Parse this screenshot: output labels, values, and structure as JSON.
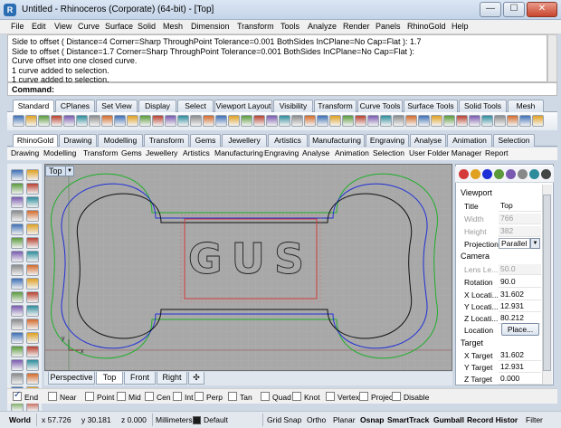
{
  "window": {
    "title": "Untitled - Rhinoceros (Corporate) (64-bit) - [Top]",
    "app_icon": "R",
    "buttons": {
      "minimize": "—",
      "maximize": "☐",
      "close": "✕"
    }
  },
  "menu": [
    "File",
    "Edit",
    "View",
    "Curve",
    "Surface",
    "Solid",
    "Mesh",
    "Dimension",
    "Transform",
    "Tools",
    "Analyze",
    "Render",
    "Panels",
    "RhinoGold",
    "Help"
  ],
  "history": [
    "Side to offset ( Distance=4  Corner=Sharp  ThroughPoint  Tolerance=0.001  BothSides  InCPlane=No  Cap=Flat ): 1.7",
    "Side to offset ( Distance=1.7  Corner=Sharp  ThroughPoint  Tolerance=0.001  BothSides  InCPlane=No  Cap=Flat ):",
    "Curve offset into one closed curve.",
    "1 curve added to selection.",
    "1 curve added to selection."
  ],
  "command": {
    "label": "Command:",
    "value": ""
  },
  "toolbar_tabs_1": [
    "Standard",
    "CPlanes",
    "Set View",
    "Display",
    "Select",
    "Viewport Layout",
    "Visibility",
    "Transform",
    "Curve Tools",
    "Surface Tools",
    "Solid Tools",
    "Mesh"
  ],
  "toolbar_tabs_2": [
    "RhinoGold",
    "Drawing",
    "Modelling",
    "Transform",
    "Gems",
    "Jewellery",
    "Artistics",
    "Manufacturing",
    "Engraving",
    "Analyse",
    "Animation",
    "Selection"
  ],
  "text_toolbar": [
    "Drawing",
    "Modelling",
    "Transform",
    "Gems",
    "Jewellery",
    "Artistics",
    "Manufacturing",
    "Engraving",
    "Analyse",
    "Animation",
    "Selection",
    "User Folder Manager",
    "Report"
  ],
  "viewport": {
    "title": "Top",
    "arrow": "▼",
    "engraved_text": "GUS",
    "axis_y": "y",
    "axis_x": "x"
  },
  "viewport_tabs": [
    "Perspective",
    "Top",
    "Front",
    "Right",
    "✣"
  ],
  "osnap": [
    {
      "label": "End",
      "checked": true
    },
    {
      "label": "Near",
      "checked": false
    },
    {
      "label": "Point",
      "checked": false
    },
    {
      "label": "Mid",
      "checked": false
    },
    {
      "label": "Cen",
      "checked": false
    },
    {
      "label": "Int",
      "checked": false
    },
    {
      "label": "Perp",
      "checked": false
    },
    {
      "label": "Tan",
      "checked": false
    },
    {
      "label": "Quad",
      "checked": false
    },
    {
      "label": "Knot",
      "checked": false
    },
    {
      "label": "Vertex",
      "checked": false
    },
    {
      "label": "Project",
      "checked": false
    },
    {
      "label": "Disable",
      "checked": false
    }
  ],
  "status": {
    "world": "World",
    "x": "x 57.726",
    "y": "y 30.181",
    "z": "z 0.000",
    "units": "Millimeters",
    "layer": "Default",
    "grid_snap": "Grid Snap",
    "ortho": "Ortho",
    "planar": "Planar",
    "osnap": "Osnap",
    "smarttrack": "SmartTrack",
    "gumball": "Gumball",
    "record_history": "Record Histor",
    "filter": "Filter"
  },
  "properties": {
    "viewport_header": "Viewport",
    "title_label": "Title",
    "title_value": "Top",
    "width_label": "Width",
    "width_value": "766",
    "height_label": "Height",
    "height_value": "382",
    "projection_label": "Projection",
    "projection_value": "Parallel",
    "camera_header": "Camera",
    "lens_label": "Lens Le...",
    "lens_value": "50.0",
    "rotation_label": "Rotation",
    "rotation_value": "90.0",
    "xloc_label": "X Locati...",
    "xloc_value": "31.602",
    "yloc_label": "Y Locati...",
    "yloc_value": "12.931",
    "zloc_label": "Z Locati...",
    "zloc_value": "80.212",
    "location_label": "Location",
    "location_button": "Place...",
    "target_header": "Target",
    "xtarget_label": "X Target",
    "xtarget_value": "31.602",
    "ytarget_label": "Y Target",
    "ytarget_value": "12.931",
    "ztarget_label": "Z Target",
    "ztarget_value": "0.000"
  },
  "colors": {
    "viewport_bg": "#a9a9a9",
    "grid_line": "#b4b4b4",
    "inner_curve": "#000000",
    "offset_blue": "#1f2fd6",
    "offset_green": "#1fae2a",
    "text_box": "#d43a3a"
  }
}
